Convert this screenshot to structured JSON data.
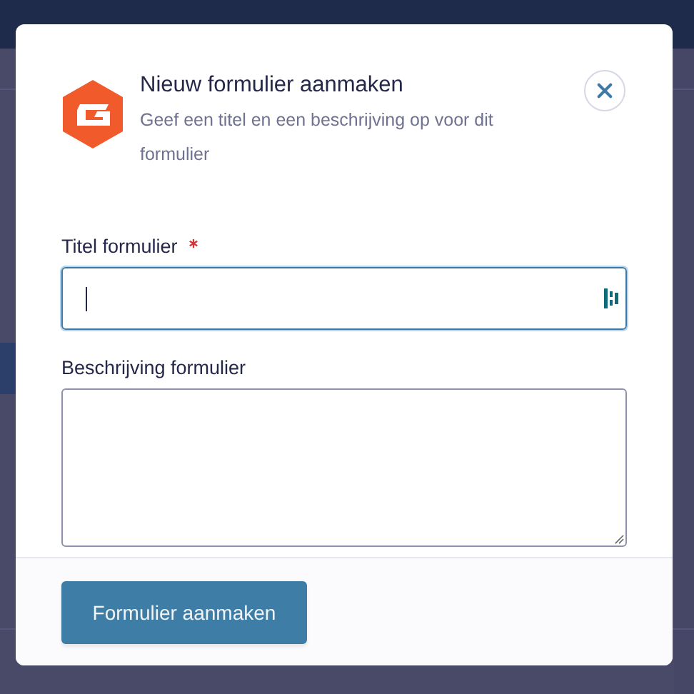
{
  "dialog": {
    "title": "Nieuw formulier aanmaken",
    "subtitle": "Geef een titel en een beschrijving op voor dit formulier",
    "fields": [
      {
        "kind": "input",
        "label": "Titel formulier",
        "required": true,
        "focused": true
      },
      {
        "kind": "textarea",
        "label": "Beschrijving formulier",
        "required": false,
        "focused": false
      }
    ],
    "submit_button": "Formulier aanmaken"
  }
}
